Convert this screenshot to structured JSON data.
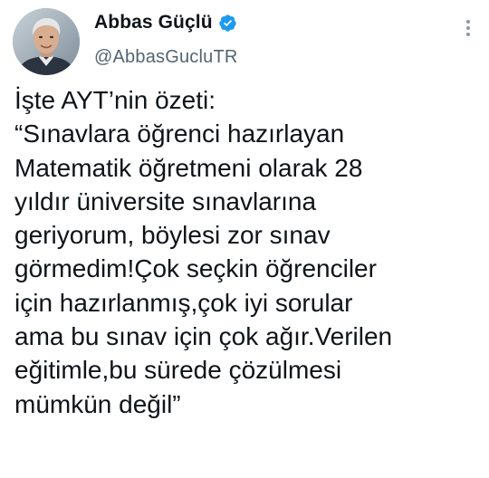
{
  "author": {
    "display_name": "Abbas Güçlü",
    "handle": "@AbbasGucluTR",
    "verified": true,
    "avatar_icon": "profile-photo"
  },
  "tweet": {
    "text": "İşte AYT’nin özeti:\n“Sınavlara öğrenci hazırlayan\nMatematik öğretmeni olarak 28\nyıldır üniversite sınavlarına\ngeriyorum, böylesi zor sınav\ngörmedim!Çok seçkin öğrenciler\niçin hazırlanmış,çok iyi sorular\nama bu sınav için çok ağır.Verilen\neğitimle,bu sürede çözülmesi\nmümkün değil”"
  },
  "colors": {
    "verified_badge": "#1d9bf0",
    "text": "#0f1419",
    "secondary_text": "#536471",
    "more_icon": "#8b98a5"
  }
}
